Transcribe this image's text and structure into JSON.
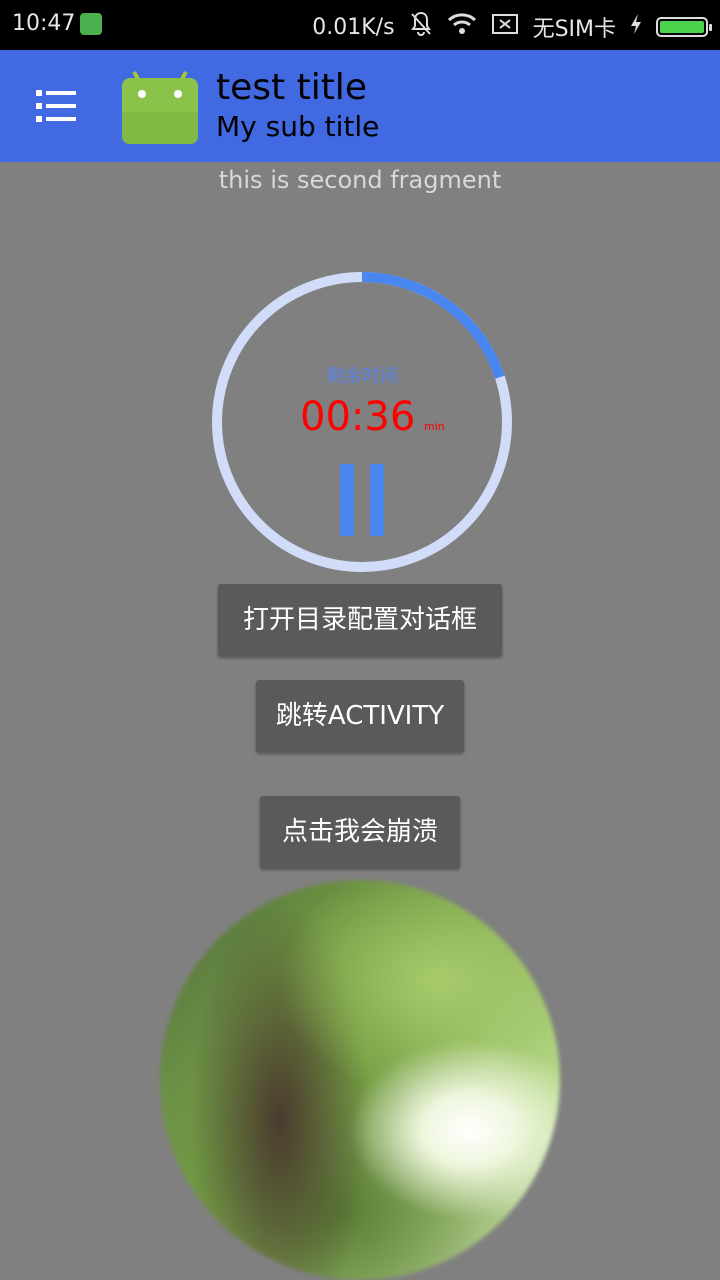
{
  "status_bar": {
    "time": "10:47",
    "net_speed": "0.01K/s",
    "sim_status": "无SIM卡",
    "icons": [
      "notification-app-icon",
      "bell-off-icon",
      "wifi-icon",
      "no-sim-icon",
      "charging-icon",
      "battery-icon"
    ],
    "battery_level": 1.0
  },
  "toolbar": {
    "title": "test title",
    "subtitle": "My sub title",
    "color": "#4169e1"
  },
  "content": {
    "fragment_text": "this is second fragment",
    "timer": {
      "label": "剩余时间",
      "value": "00:36",
      "unit": "min",
      "progress": 0.2,
      "progress_color": "#4a86f0",
      "track_color": "#d0dcf8",
      "value_color": "#ff0000"
    },
    "buttons": {
      "open_dialog": "打开目录配置对话框",
      "jump_activity": "跳转ACTIVITY",
      "crash": "点击我会崩溃"
    }
  },
  "colors": {
    "background": "#808080",
    "button": "#5a5a5a"
  }
}
